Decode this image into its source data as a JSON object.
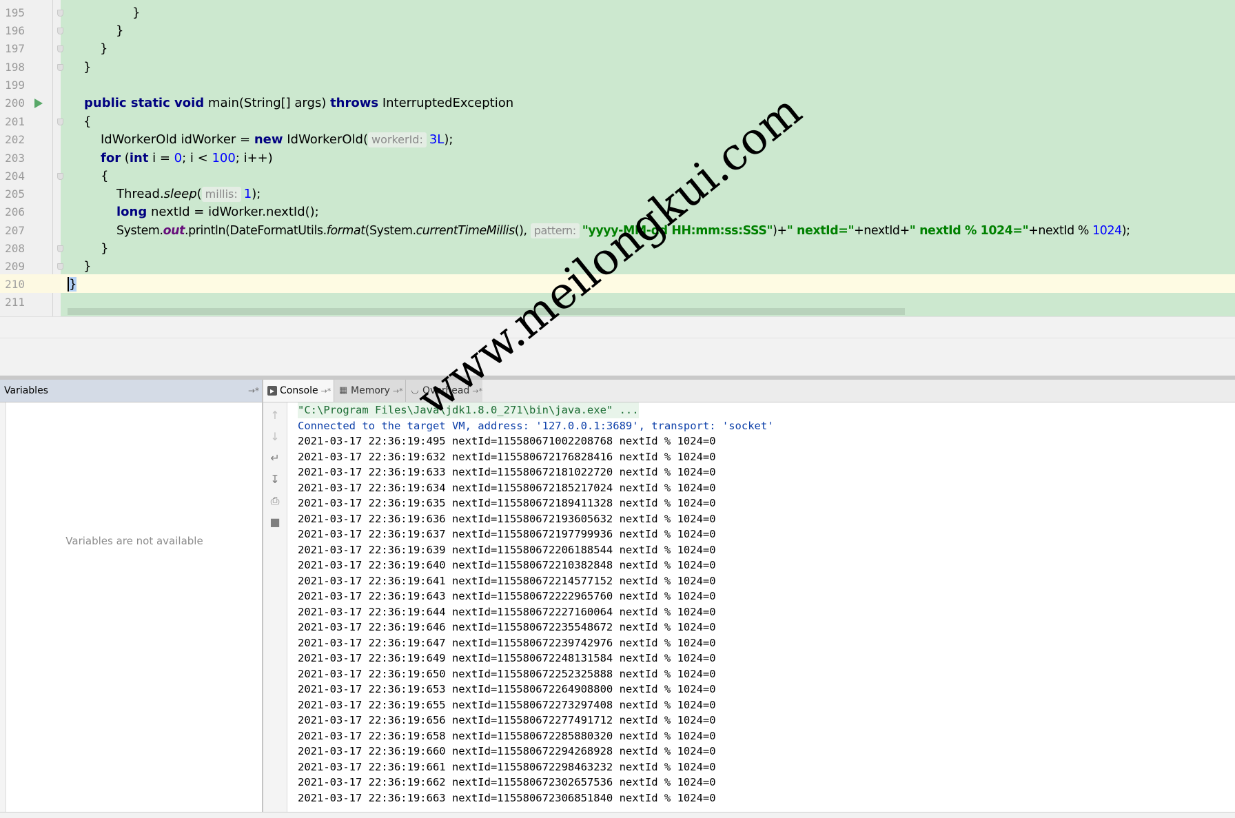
{
  "editor": {
    "line_numbers": [
      "195",
      "196",
      "197",
      "198",
      "199",
      "200",
      "201",
      "202",
      "203",
      "204",
      "205",
      "206",
      "207",
      "208",
      "209",
      "210",
      "211"
    ],
    "code": {
      "l195": "}",
      "l196": "}",
      "l197": "}",
      "l198": "}",
      "l200_kw": "public static void",
      "l200_sig": " main(String[] args) ",
      "l200_throws": "throws",
      "l200_exc": " InterruptedException",
      "l201": "{",
      "l202_a": "IdWorkerOld idWorker = ",
      "l202_new": "new",
      "l202_b": " IdWorkerOld(",
      "l202_hint": "workerId:",
      "l202_num": "3L",
      "l202_end": ");",
      "l203_for": "for",
      "l203_a": " (",
      "l203_int": "int",
      "l203_b": " i = ",
      "l203_zero": "0",
      "l203_c": "; i < ",
      "l203_hundred": "100",
      "l203_d": "; i++)",
      "l204": "{",
      "l205_a": "Thread.",
      "l205_sleep": "sleep",
      "l205_b": "(",
      "l205_hint": "millis:",
      "l205_num": "1",
      "l205_end": ");",
      "l206_long": "long",
      "l206_rest": " nextId = idWorker.nextId();",
      "l207_a": "System.",
      "l207_out": "out",
      "l207_b": ".println(DateFormatUtils.",
      "l207_format": "format",
      "l207_c": "(System.",
      "l207_ctm": "currentTimeMillis",
      "l207_d": "(), ",
      "l207_hint": "pattern:",
      "l207_str1": "\"yyyy-MM-dd HH:mm:ss:SSS\"",
      "l207_e": ")+",
      "l207_str2": "\" nextId=\"",
      "l207_f": "+nextId+",
      "l207_str3": "\" nextId % 1024=\"",
      "l207_g": "+nextId % ",
      "l207_num": "1024",
      "l207_end": ");",
      "l208": "}",
      "l209": "}",
      "l210": "}"
    }
  },
  "variables": {
    "title": "Variables",
    "empty_message": "Variables are not available"
  },
  "tabs": {
    "console": "Console",
    "memory": "Memory",
    "overhead": "Overhead",
    "pin": "→*"
  },
  "console": {
    "command": "\"C:\\Program Files\\Java\\jdk1.8.0_271\\bin\\java.exe\" ...",
    "connected": "Connected to the target VM, address: '127.0.0.1:3689', transport: 'socket'",
    "lines": [
      "2021-03-17 22:36:19:495 nextId=115580671002208768 nextId % 1024=0",
      "2021-03-17 22:36:19:632 nextId=115580672176828416 nextId % 1024=0",
      "2021-03-17 22:36:19:633 nextId=115580672181022720 nextId % 1024=0",
      "2021-03-17 22:36:19:634 nextId=115580672185217024 nextId % 1024=0",
      "2021-03-17 22:36:19:635 nextId=115580672189411328 nextId % 1024=0",
      "2021-03-17 22:36:19:636 nextId=115580672193605632 nextId % 1024=0",
      "2021-03-17 22:36:19:637 nextId=115580672197799936 nextId % 1024=0",
      "2021-03-17 22:36:19:639 nextId=115580672206188544 nextId % 1024=0",
      "2021-03-17 22:36:19:640 nextId=115580672210382848 nextId % 1024=0",
      "2021-03-17 22:36:19:641 nextId=115580672214577152 nextId % 1024=0",
      "2021-03-17 22:36:19:643 nextId=115580672222965760 nextId % 1024=0",
      "2021-03-17 22:36:19:644 nextId=115580672227160064 nextId % 1024=0",
      "2021-03-17 22:36:19:646 nextId=115580672235548672 nextId % 1024=0",
      "2021-03-17 22:36:19:647 nextId=115580672239742976 nextId % 1024=0",
      "2021-03-17 22:36:19:649 nextId=115580672248131584 nextId % 1024=0",
      "2021-03-17 22:36:19:650 nextId=115580672252325888 nextId % 1024=0",
      "2021-03-17 22:36:19:653 nextId=115580672264908800 nextId % 1024=0",
      "2021-03-17 22:36:19:655 nextId=115580672273297408 nextId % 1024=0",
      "2021-03-17 22:36:19:656 nextId=115580672277491712 nextId % 1024=0",
      "2021-03-17 22:36:19:658 nextId=115580672285880320 nextId % 1024=0",
      "2021-03-17 22:36:19:660 nextId=115580672294268928 nextId % 1024=0",
      "2021-03-17 22:36:19:661 nextId=115580672298463232 nextId % 1024=0",
      "2021-03-17 22:36:19:662 nextId=115580672302657536 nextId % 1024=0",
      "2021-03-17 22:36:19:663 nextId=115580672306851840 nextId % 1024=0"
    ]
  },
  "watermark": "www.meilongkui.com",
  "icons": {
    "run": "run-gutter-icon",
    "up": "arrow-up-icon",
    "down": "arrow-down-icon",
    "wrap": "soft-wrap-icon",
    "scroll_end": "scroll-to-end-icon",
    "print": "print-icon",
    "clear": "trash-icon"
  },
  "colors": {
    "editor_bg": "#cce8cf",
    "keyword": "#000080",
    "string": "#008000",
    "number": "#0000ff",
    "console_connected": "#0b3ea8"
  }
}
